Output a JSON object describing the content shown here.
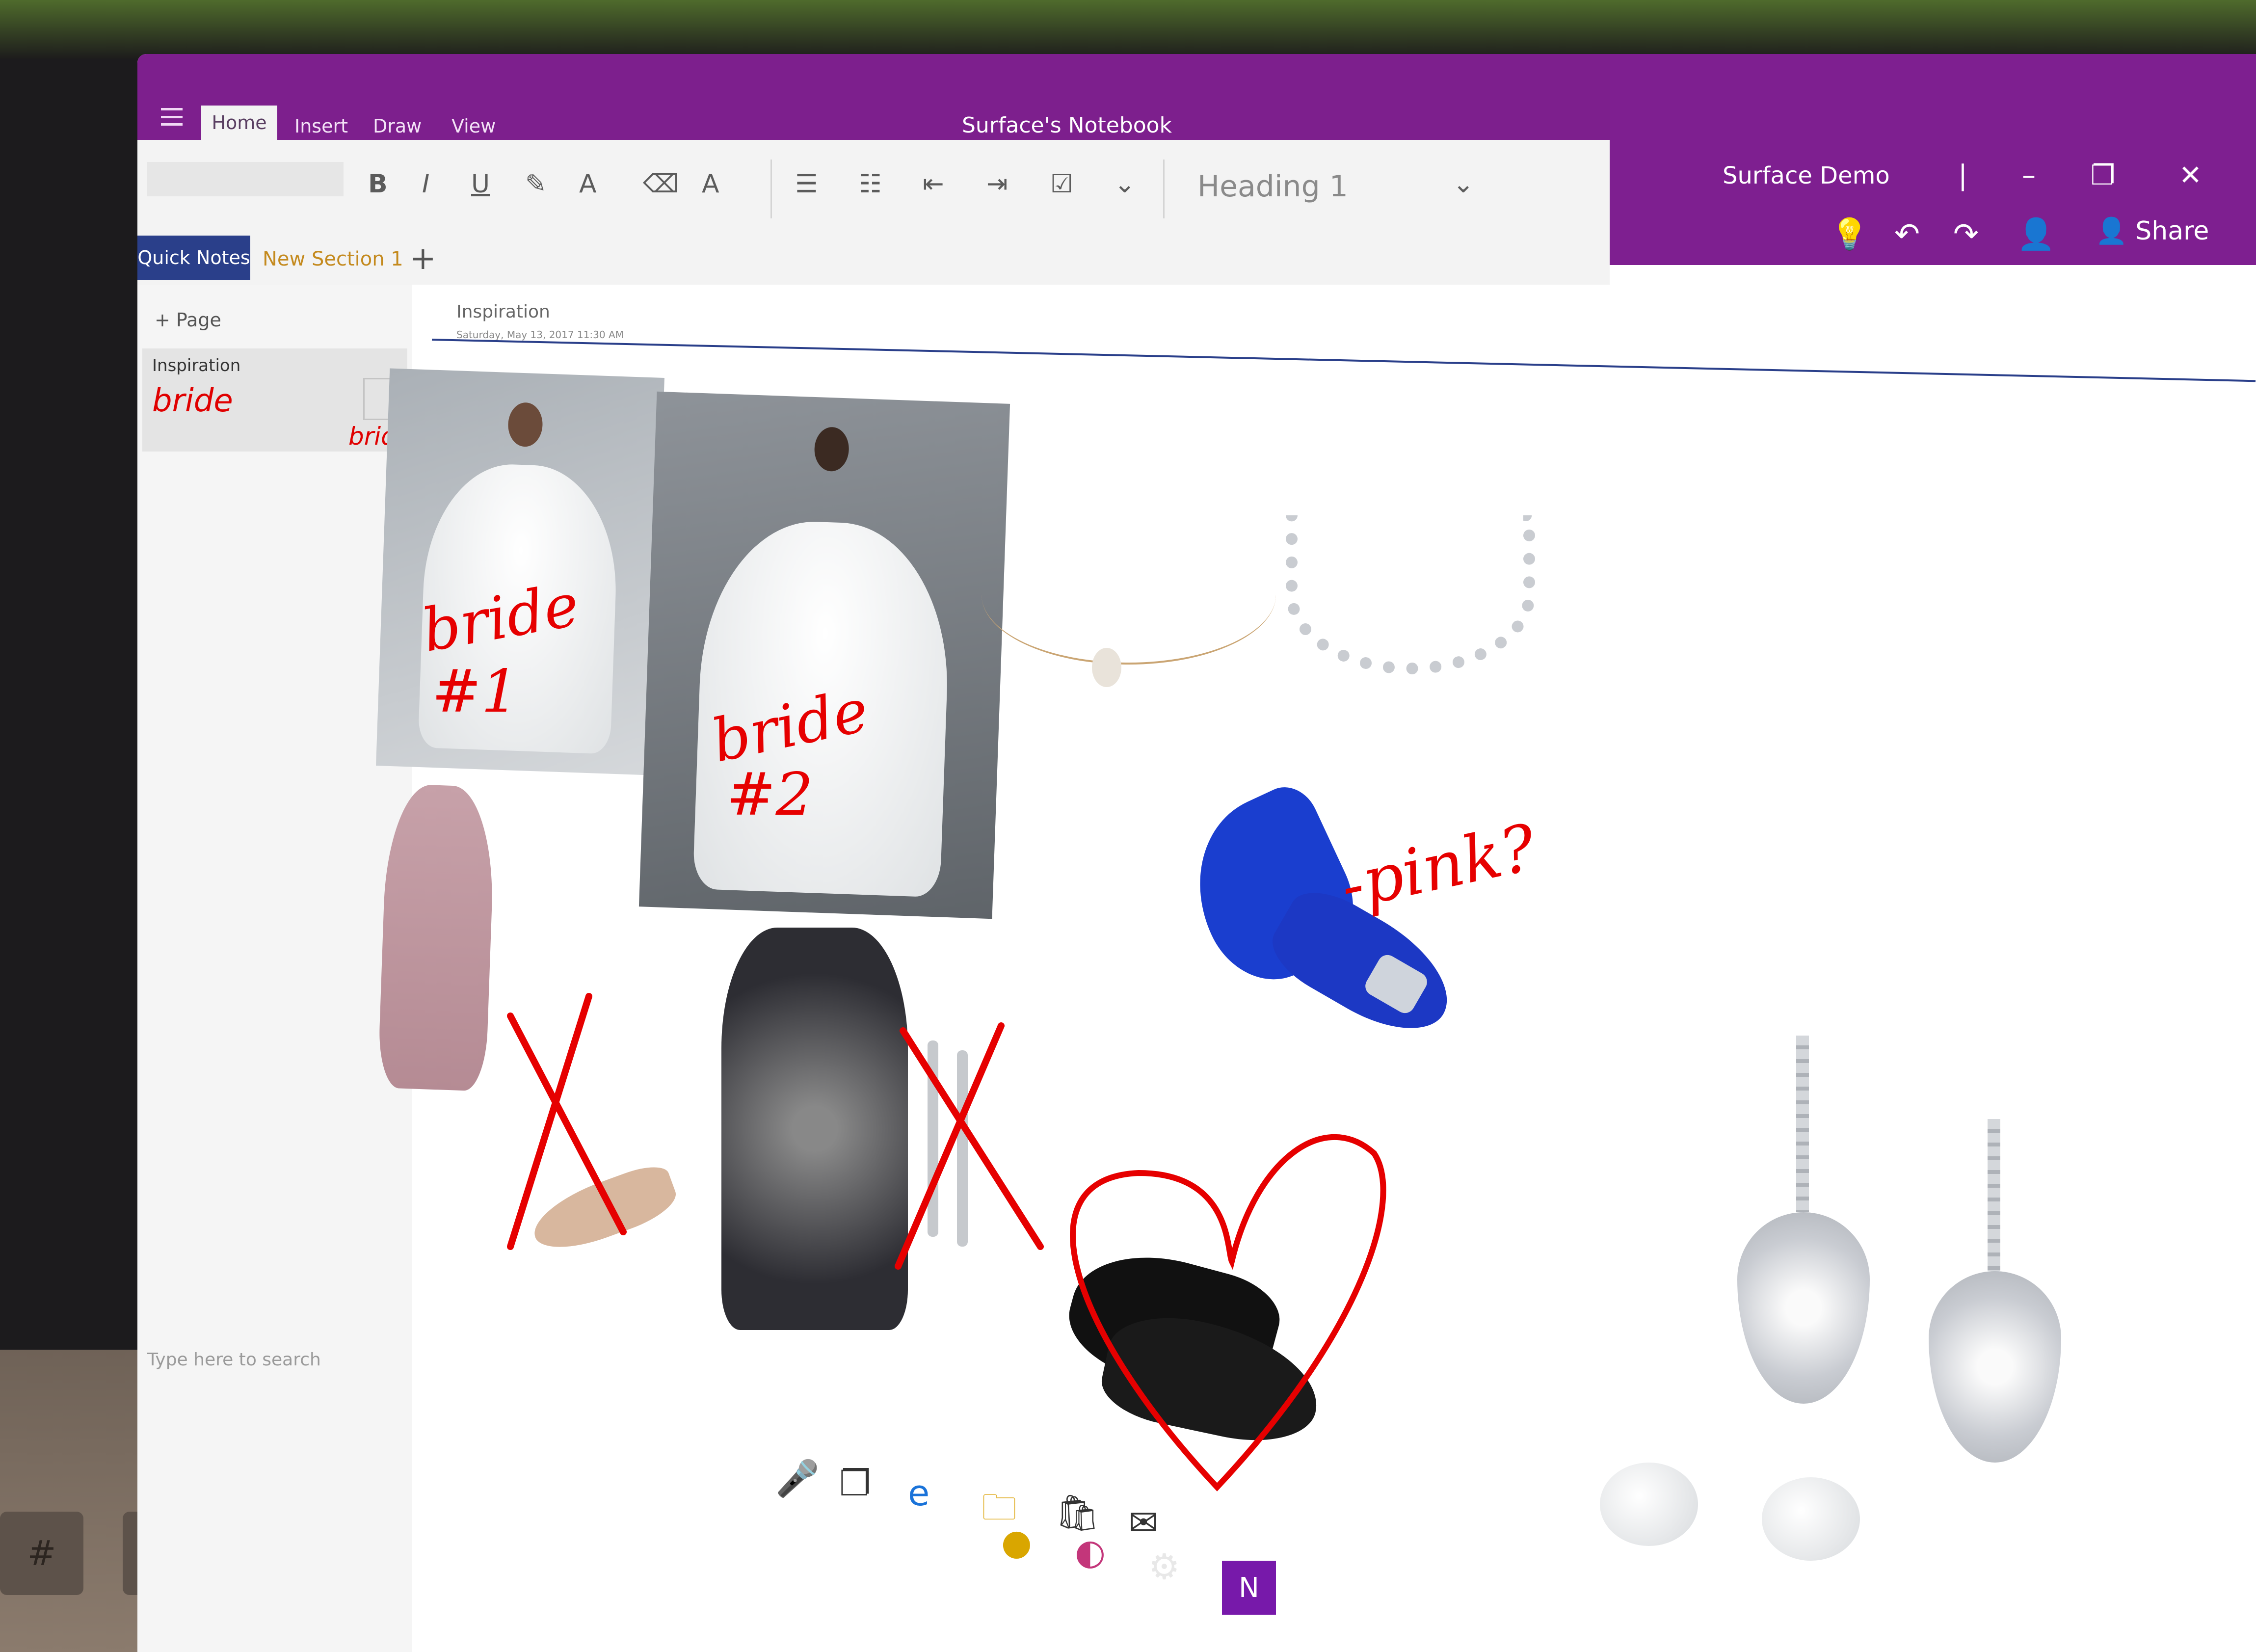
{
  "app": {
    "window_title": "Surface's Notebook",
    "account_name": "Surface Demo"
  },
  "ribbon": {
    "tabs": [
      {
        "label": "Home",
        "active": true
      },
      {
        "label": "Insert",
        "active": false
      },
      {
        "label": "Draw",
        "active": false
      },
      {
        "label": "View",
        "active": false
      }
    ],
    "format_buttons": [
      "B",
      "I",
      "U"
    ],
    "style_value": "Heading 1"
  },
  "right_toolbar": {
    "share_label": "Share"
  },
  "sections": {
    "tabs": [
      {
        "label": "Quick Notes",
        "active": true
      },
      {
        "label": "New Section 1",
        "active": false
      }
    ],
    "add_label": "+"
  },
  "pages": {
    "add_label": "Page",
    "items": [
      {
        "title": "Inspiration"
      }
    ],
    "thumb_ink": "bride",
    "thumb_ink_2": "brid"
  },
  "page": {
    "title": "Inspiration",
    "date": "Saturday, May 13, 2017     11:30 AM"
  },
  "ink": {
    "bride1": "bride",
    "bride1_num": "#1",
    "bride2": "bride",
    "bride2_num": "#2",
    "pink_note": "-pink?"
  },
  "taskbar": {
    "search_placeholder": "Type here to search"
  },
  "colors": {
    "title_bar": "#7d1f8d",
    "section_active": "#2a3f8a",
    "ink": "#e60000"
  }
}
